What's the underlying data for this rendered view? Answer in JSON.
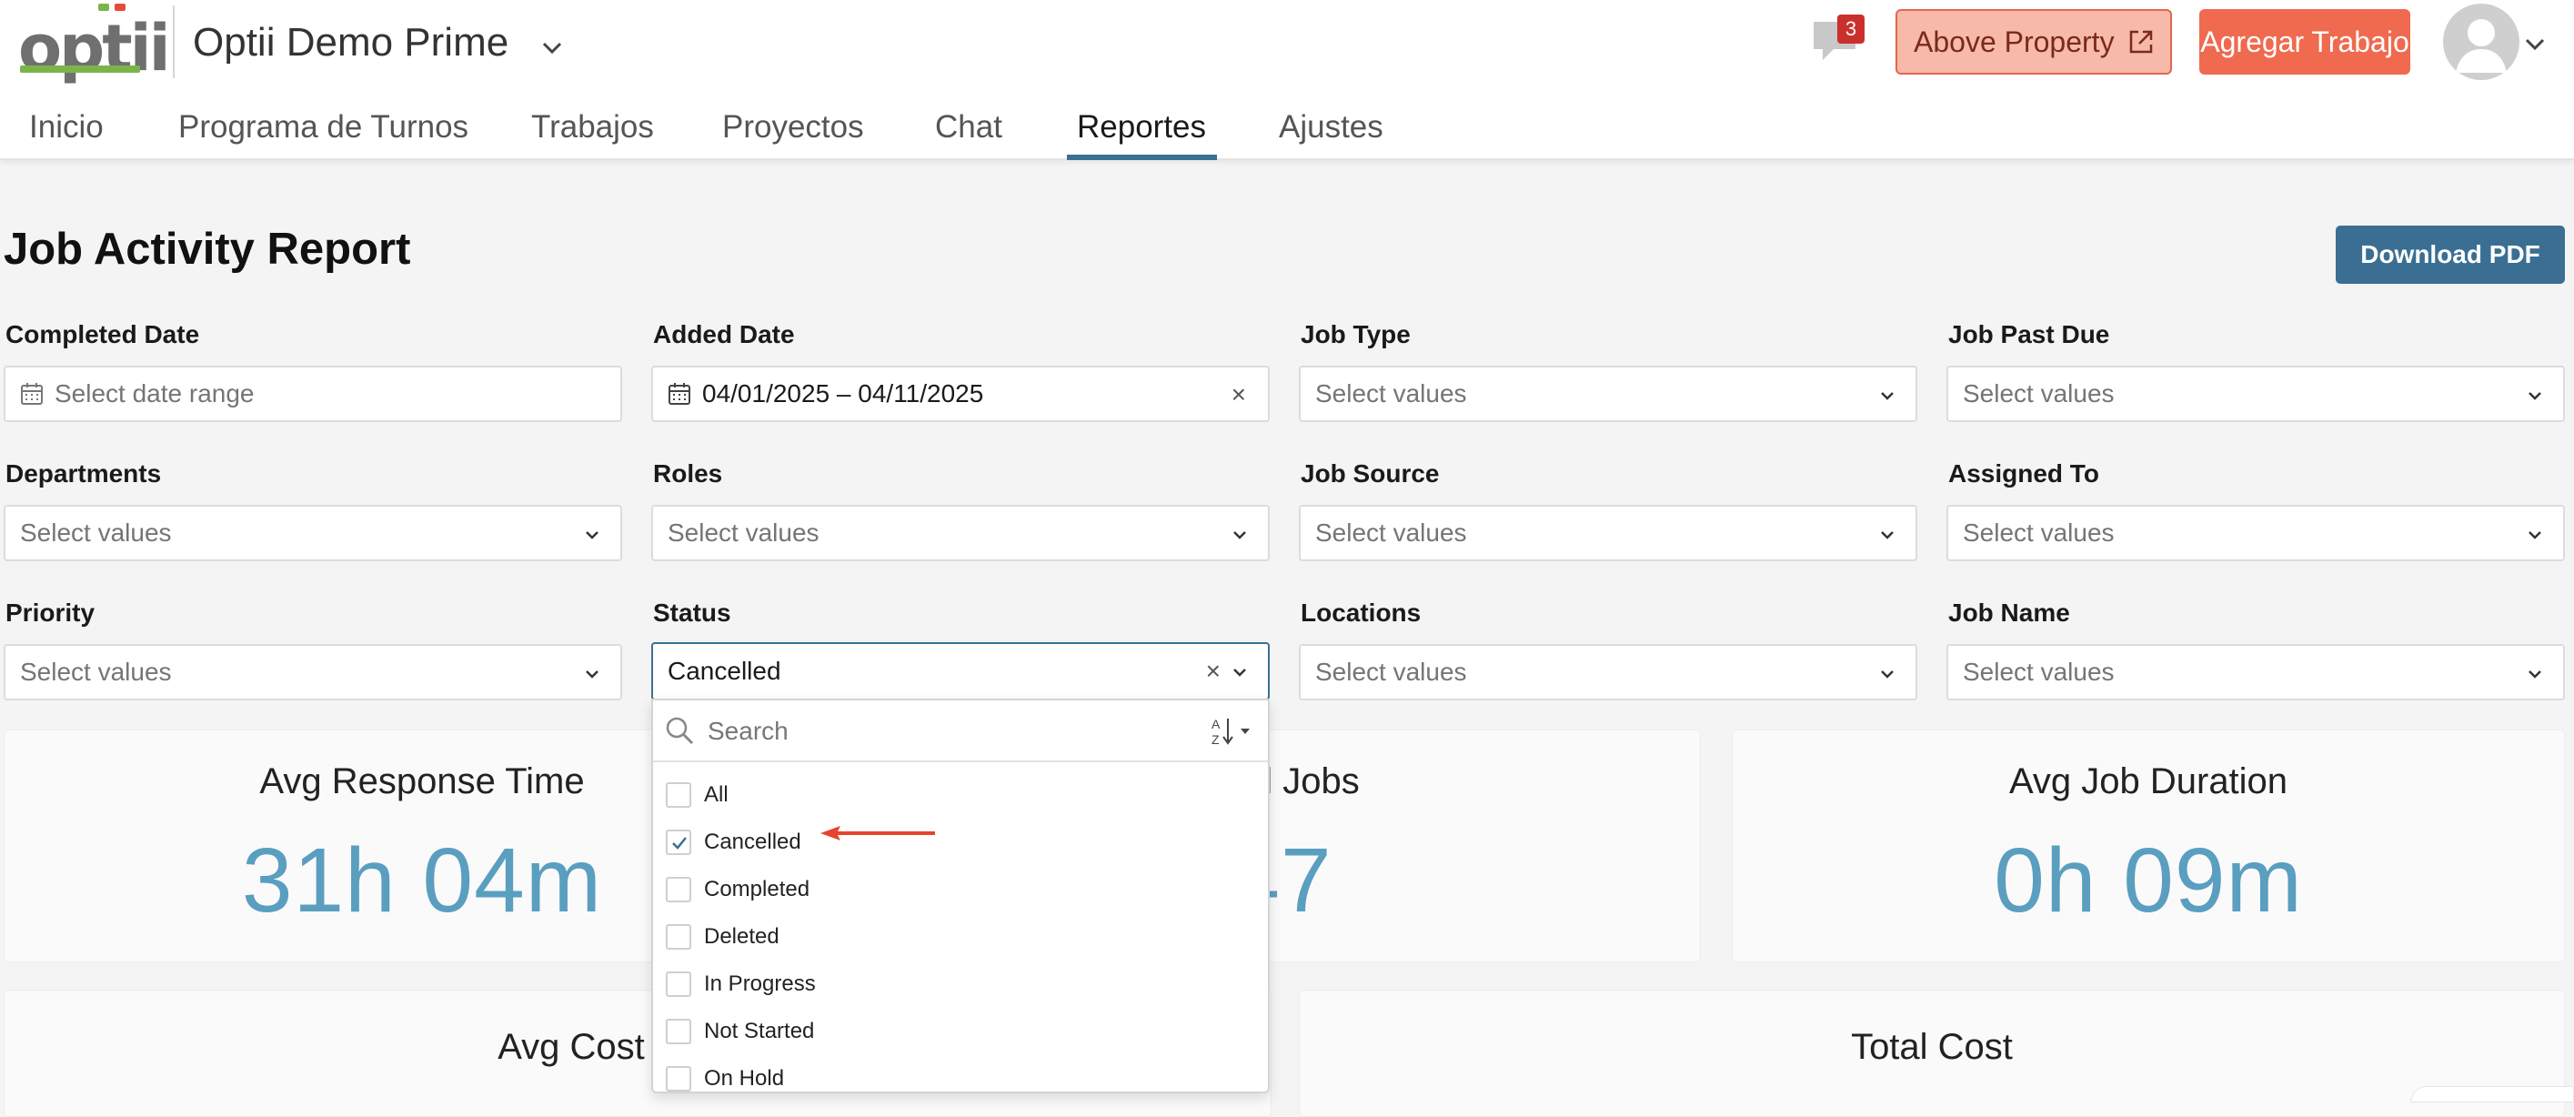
{
  "app": {
    "logo_text": "optii",
    "property_name": "Optii Demo Prime",
    "notifications_count": "3",
    "above_property_label": "Above Property",
    "add_job_label": "Agregar Trabajo"
  },
  "nav": {
    "tabs": [
      {
        "label": "Inicio"
      },
      {
        "label": "Programa de Turnos"
      },
      {
        "label": "Trabajos"
      },
      {
        "label": "Proyectos"
      },
      {
        "label": "Chat"
      },
      {
        "label": "Reportes",
        "active": true
      },
      {
        "label": "Ajustes"
      }
    ]
  },
  "report": {
    "title": "Job Activity Report",
    "download_label": "Download PDF"
  },
  "filters": {
    "completed_date": {
      "label": "Completed Date",
      "placeholder": "Select date range"
    },
    "added_date": {
      "label": "Added Date",
      "value": "04/01/2025 – 04/11/2025"
    },
    "job_type": {
      "label": "Job Type",
      "placeholder": "Select values"
    },
    "job_past_due": {
      "label": "Job Past Due",
      "placeholder": "Select values"
    },
    "departments": {
      "label": "Departments",
      "placeholder": "Select values"
    },
    "roles": {
      "label": "Roles",
      "placeholder": "Select values"
    },
    "job_source": {
      "label": "Job Source",
      "placeholder": "Select values"
    },
    "assigned_to": {
      "label": "Assigned To",
      "placeholder": "Select values"
    },
    "priority": {
      "label": "Priority",
      "placeholder": "Select values"
    },
    "status": {
      "label": "Status",
      "value": "Cancelled"
    },
    "locations": {
      "label": "Locations",
      "placeholder": "Select values"
    },
    "job_name": {
      "label": "Job Name",
      "placeholder": "Select values"
    }
  },
  "status_dropdown": {
    "search_placeholder": "Search",
    "options": [
      {
        "label": "All",
        "checked": false
      },
      {
        "label": "Cancelled",
        "checked": true
      },
      {
        "label": "Completed",
        "checked": false
      },
      {
        "label": "Deleted",
        "checked": false
      },
      {
        "label": "In Progress",
        "checked": false
      },
      {
        "label": "Not Started",
        "checked": false
      },
      {
        "label": "On Hold",
        "checked": false
      }
    ]
  },
  "stats": {
    "avg_response_time": {
      "title": "Avg Response Time",
      "value": "31h 04m"
    },
    "completed_jobs": {
      "title": "eted Jobs",
      "value": "47"
    },
    "avg_job_duration": {
      "title": "Avg Job Duration",
      "value": "0h 09m"
    },
    "avg_cost": {
      "title": "Avg Cost"
    },
    "total_cost": {
      "title": "Total Cost"
    }
  },
  "colors": {
    "accent": "#3a6f93",
    "stat_value": "#5a9ec0",
    "primary_action": "#ef6a4f",
    "annotation_arrow": "#e8432d"
  }
}
